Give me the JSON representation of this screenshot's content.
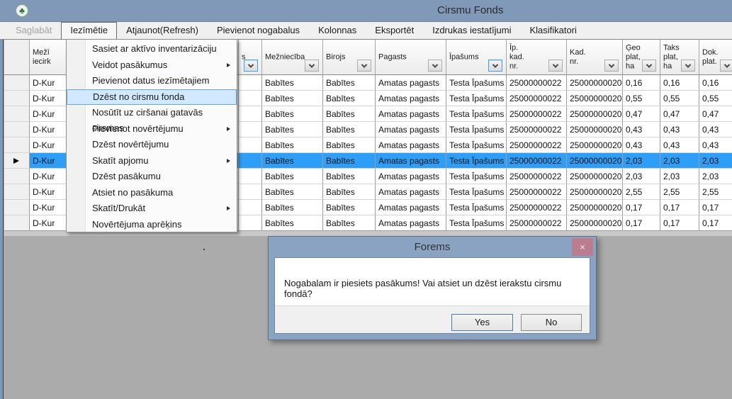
{
  "window_title": "Cirsmu Fonds",
  "menu_bar": {
    "items": [
      {
        "label": "Saglabāt",
        "state": "disabled"
      },
      {
        "label": "Iezīmētie",
        "state": "open"
      },
      {
        "label": "Atjaunot(Refresh)",
        "state": "normal"
      },
      {
        "label": "Pievienot nogabalus",
        "state": "normal"
      },
      {
        "label": "Kolonnas",
        "state": "normal"
      },
      {
        "label": "Eksportēt",
        "state": "normal"
      },
      {
        "label": "Izdrukas iestatījumi",
        "state": "normal"
      },
      {
        "label": "Klasifikatori",
        "state": "normal"
      }
    ]
  },
  "context_menu": {
    "items": [
      {
        "label": "Sasiet ar aktīvo inventarizāciju",
        "has_submenu": false,
        "highlighted": false
      },
      {
        "label": "Veidot pasākumus",
        "has_submenu": true,
        "highlighted": false
      },
      {
        "label": "Pievienot datus iezīmētajiem",
        "has_submenu": false,
        "highlighted": false
      },
      {
        "label": "Dzēst no cirsmu fonda",
        "has_submenu": false,
        "highlighted": true
      },
      {
        "label": "Nosūtīt uz ciršanai gatavās cirsmas",
        "has_submenu": false,
        "highlighted": false
      },
      {
        "label": "Pievienot novērtējumu",
        "has_submenu": true,
        "highlighted": false
      },
      {
        "label": "Dzēst novērtējumu",
        "has_submenu": false,
        "highlighted": false
      },
      {
        "label": "Skatīt apjomu",
        "has_submenu": true,
        "highlighted": false
      },
      {
        "label": "Dzēst pasākumu",
        "has_submenu": false,
        "highlighted": false
      },
      {
        "label": "Atsiet no pasākuma",
        "has_submenu": false,
        "highlighted": false
      },
      {
        "label": "Skatīt/Drukāt",
        "has_submenu": true,
        "highlighted": false
      },
      {
        "label": "Novērtējuma aprēķins",
        "has_submenu": false,
        "highlighted": false
      }
    ]
  },
  "table": {
    "columns": [
      {
        "key": "selector",
        "lines": [],
        "filter": null
      },
      {
        "key": "iecirknis",
        "lines": [
          "Mežī",
          "iecirk"
        ],
        "filter": null
      },
      {
        "key": "fill",
        "lines": [],
        "filter": null
      },
      {
        "key": "partial",
        "lines": [
          "s"
        ],
        "filter": "focused"
      },
      {
        "key": "meznieciba",
        "lines": [
          "Mežniecība"
        ],
        "filter": "normal"
      },
      {
        "key": "birojs",
        "lines": [
          "Birojs"
        ],
        "filter": "normal"
      },
      {
        "key": "pagasts",
        "lines": [
          "Pagasts"
        ],
        "filter": "normal"
      },
      {
        "key": "ipasums",
        "lines": [
          "Īpašums"
        ],
        "filter": "focused"
      },
      {
        "key": "ip_kad_nr",
        "lines": [
          "Īp.",
          "kad.",
          "nr."
        ],
        "filter": "normal"
      },
      {
        "key": "kad_nr",
        "lines": [
          "Kad.",
          "nr."
        ],
        "filter": "normal"
      },
      {
        "key": "geo",
        "lines": [
          "Ģeo",
          "plat,",
          "ha"
        ],
        "filter": "normal"
      },
      {
        "key": "taks",
        "lines": [
          "Taks",
          "plat,",
          "ha"
        ],
        "filter": "normal"
      },
      {
        "key": "dok",
        "lines": [
          "Dok.",
          "plat."
        ],
        "filter": "normal"
      }
    ],
    "selected_row_index": 5,
    "rows": [
      {
        "iecirknis": "D-Kur",
        "meznieciba": "Babītes",
        "birojs": "Babītes",
        "pagasts": "Amatas pagasts",
        "ipasums": "Testa Īpašums",
        "ip_kad_nr": "25000000022",
        "kad_nr": "25000000020",
        "geo": "0,16",
        "taks": "0,16",
        "dok": "0,16"
      },
      {
        "iecirknis": "D-Kur",
        "meznieciba": "Babītes",
        "birojs": "Babītes",
        "pagasts": "Amatas pagasts",
        "ipasums": "Testa Īpašums",
        "ip_kad_nr": "25000000022",
        "kad_nr": "25000000020",
        "geo": "0,55",
        "taks": "0,55",
        "dok": "0,55"
      },
      {
        "iecirknis": "D-Kur",
        "meznieciba": "Babītes",
        "birojs": "Babītes",
        "pagasts": "Amatas pagasts",
        "ipasums": "Testa Īpašums",
        "ip_kad_nr": "25000000022",
        "kad_nr": "25000000020",
        "geo": "0,47",
        "taks": "0,47",
        "dok": "0,47"
      },
      {
        "iecirknis": "D-Kur",
        "meznieciba": "Babītes",
        "birojs": "Babītes",
        "pagasts": "Amatas pagasts",
        "ipasums": "Testa Īpašums",
        "ip_kad_nr": "25000000022",
        "kad_nr": "25000000020",
        "geo": "0,43",
        "taks": "0,43",
        "dok": "0,43"
      },
      {
        "iecirknis": "D-Kur",
        "meznieciba": "Babītes",
        "birojs": "Babītes",
        "pagasts": "Amatas pagasts",
        "ipasums": "Testa Īpašums",
        "ip_kad_nr": "25000000022",
        "kad_nr": "25000000020",
        "geo": "0,43",
        "taks": "0,43",
        "dok": "0,43"
      },
      {
        "iecirknis": "D-Kur",
        "meznieciba": "Babītes",
        "birojs": "Babītes",
        "pagasts": "Amatas pagasts",
        "ipasums": "Testa Īpašums",
        "ip_kad_nr": "25000000022",
        "kad_nr": "25000000020",
        "geo": "2,03",
        "taks": "2,03",
        "dok": "2,03"
      },
      {
        "iecirknis": "D-Kur",
        "meznieciba": "Babītes",
        "birojs": "Babītes",
        "pagasts": "Amatas pagasts",
        "ipasums": "Testa Īpašums",
        "ip_kad_nr": "25000000022",
        "kad_nr": "25000000020",
        "geo": "2,03",
        "taks": "2,03",
        "dok": "2,03"
      },
      {
        "iecirknis": "D-Kur",
        "meznieciba": "Babītes",
        "birojs": "Babītes",
        "pagasts": "Amatas pagasts",
        "ipasums": "Testa Īpašums",
        "ip_kad_nr": "25000000022",
        "kad_nr": "25000000020",
        "geo": "2,55",
        "taks": "2,55",
        "dok": "2,55"
      },
      {
        "iecirknis": "D-Kur",
        "meznieciba": "Babītes",
        "birojs": "Babītes",
        "pagasts": "Amatas pagasts",
        "ipasums": "Testa Īpašums",
        "ip_kad_nr": "25000000022",
        "kad_nr": "25000000020",
        "geo": "0,17",
        "taks": "0,17",
        "dok": "0,17"
      },
      {
        "iecirknis": "D-Kur",
        "meznieciba": "Babītes",
        "birojs": "Babītes",
        "pagasts": "Amatas pagasts",
        "ipasums": "Testa Īpašums",
        "ip_kad_nr": "25000000022",
        "kad_nr": "25000000020",
        "geo": "0,17",
        "taks": "0,17",
        "dok": "0,17"
      }
    ]
  },
  "dialog": {
    "title": "Forems",
    "message": "Nogabalam ir piesiets pasākums! Vai atsiet un dzēst ierakstu cirsmu fondā?",
    "yes_label": "Yes",
    "no_label": "No",
    "close_label": "×"
  },
  "icons": {
    "app": "leaf-icon",
    "filter": "chevron-down-icon",
    "submenu": "arrow-right-icon",
    "row_selector": "arrow-right-icon",
    "close": "close-icon"
  },
  "colors": {
    "titlebar": "#8099b9",
    "client_bg": "#ababab",
    "selection": "#2e9ef6",
    "menu_highlight": "#d1e8ff",
    "menu_highlight_border": "#66a7e8",
    "dialog_frame": "#8aa3c3",
    "dialog_close": "#bb7e90"
  }
}
